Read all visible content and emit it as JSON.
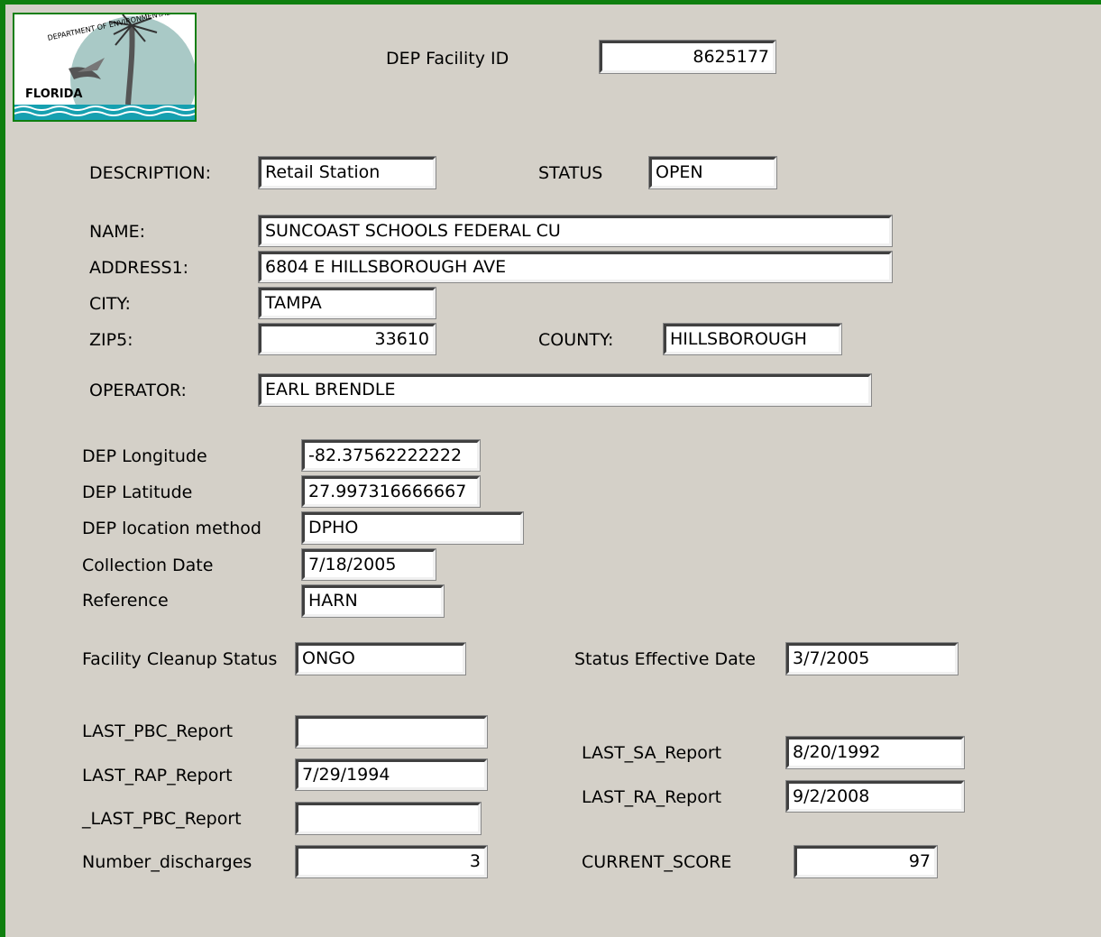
{
  "logo": {
    "agency_text": "DEPARTMENT OF ENVIRONMENTAL PROTECTION",
    "state_text": "FLORIDA",
    "colors": {
      "frame": "#0f7f0f",
      "circle": "#a9c9c6",
      "water": "#16a0b0"
    }
  },
  "header": {
    "facility_id_label": "DEP  Facility ID",
    "facility_id": "8625177"
  },
  "description": {
    "label": "DESCRIPTION:",
    "value": "Retail Station"
  },
  "status": {
    "label": "STATUS",
    "value": "OPEN"
  },
  "name": {
    "label": "NAME:",
    "value": "SUNCOAST SCHOOLS FEDERAL CU"
  },
  "address1": {
    "label": "ADDRESS1:",
    "value": "6804 E HILLSBOROUGH AVE"
  },
  "city": {
    "label": "CITY:",
    "value": "TAMPA"
  },
  "zip5": {
    "label": "ZIP5:",
    "value": "33610"
  },
  "county": {
    "label": "COUNTY:",
    "value": "HILLSBOROUGH"
  },
  "operator": {
    "label": "OPERATOR:",
    "value": "EARL BRENDLE"
  },
  "longitude": {
    "label": "DEP Longitude",
    "value": "-82.37562222222"
  },
  "latitude": {
    "label": "DEP Latitude",
    "value": "27.997316666667"
  },
  "location_method": {
    "label": "DEP location method",
    "value": "DPHO"
  },
  "collection_date": {
    "label": "Collection Date",
    "value": "7/18/2005"
  },
  "reference": {
    "label": "Reference",
    "value": "HARN"
  },
  "cleanup_status": {
    "label": "Facility Cleanup Status",
    "value": "ONGO"
  },
  "status_effective_date": {
    "label": "Status Effective Date",
    "value": "3/7/2005"
  },
  "last_pbc_report": {
    "label": "LAST_PBC_Report",
    "value": ""
  },
  "last_rap_report": {
    "label": "LAST_RAP_Report",
    "value": "7/29/1994"
  },
  "last_pbc_report2": {
    "label": "_LAST_PBC_Report",
    "value": ""
  },
  "number_discharges": {
    "label": "Number_discharges",
    "value": "3"
  },
  "last_sa_report": {
    "label": "LAST_SA_Report",
    "value": "8/20/1992"
  },
  "last_ra_report": {
    "label": "LAST_RA_Report",
    "value": "9/2/2008"
  },
  "current_score": {
    "label": "CURRENT_SCORE",
    "value": "97"
  }
}
